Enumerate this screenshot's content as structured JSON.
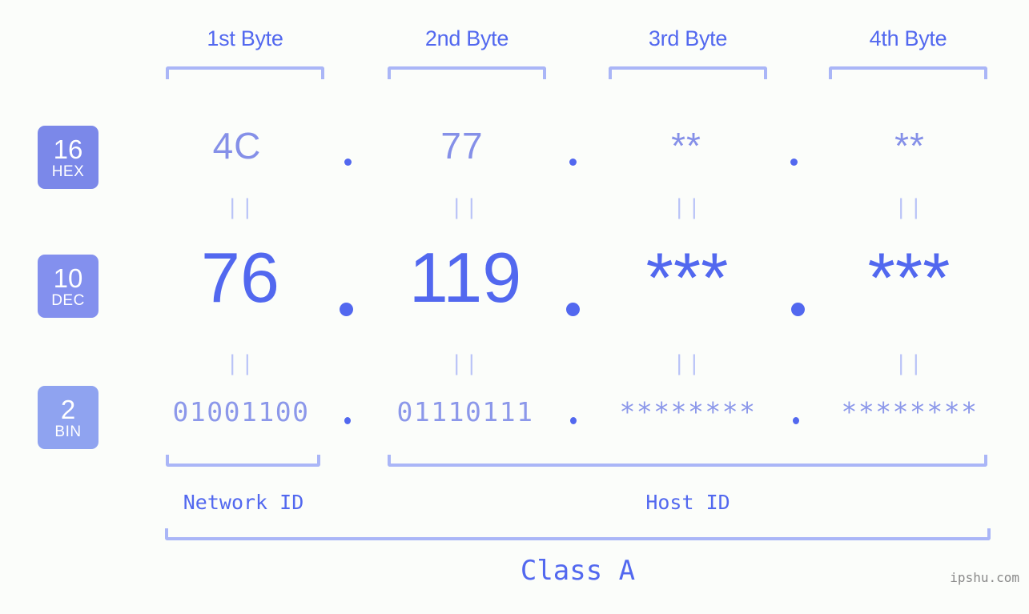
{
  "meta": {
    "background_color": "#fbfdfa",
    "accent_color": "#5268ef",
    "bracket_color": "#aab6f7",
    "watermark": "ipshu.com"
  },
  "byte_headers": [
    {
      "label": "1st Byte"
    },
    {
      "label": "2nd Byte"
    },
    {
      "label": "3rd Byte"
    },
    {
      "label": "4th Byte"
    }
  ],
  "rows": [
    {
      "base": "16",
      "base_name": "HEX",
      "badge_color": "#7b88e9",
      "values": [
        "4C",
        "77",
        "**",
        "**"
      ]
    },
    {
      "base": "10",
      "base_name": "DEC",
      "badge_color": "#8390ee",
      "values": [
        "76",
        "119",
        "***",
        "***"
      ]
    },
    {
      "base": "2",
      "base_name": "BIN",
      "badge_color": "#8fa3f0",
      "values": [
        "01001100",
        "01110111",
        "********",
        "********"
      ]
    }
  ],
  "separators": {
    "dot": ".",
    "equality": "||"
  },
  "sections": {
    "network_id": "Network ID",
    "host_id": "Host ID",
    "class": "Class A"
  }
}
